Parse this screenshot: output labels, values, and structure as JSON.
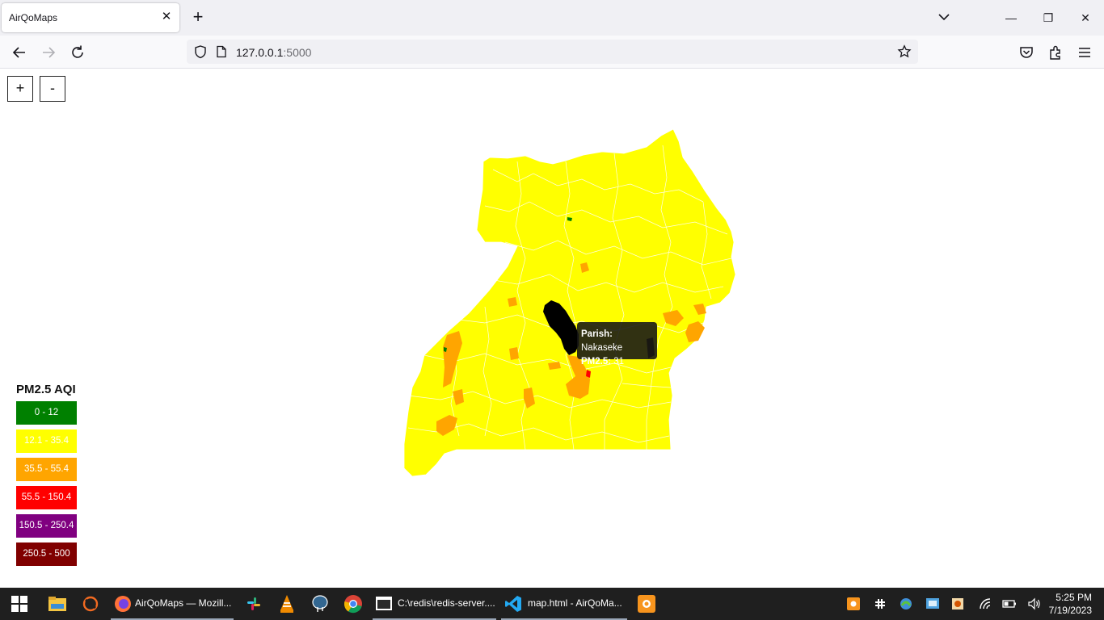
{
  "browser": {
    "tab_title": "AirQoMaps",
    "tab_close": "✕",
    "new_tab": "+",
    "url_host": "127.0.0.1",
    "url_port": ":5000",
    "window_min": "—",
    "window_restore": "❐",
    "window_close": "✕"
  },
  "map": {
    "zoom_in": "+",
    "zoom_out": "-",
    "tooltip": {
      "parish_label": "Parish:",
      "parish_value": "Nakaseke",
      "pm_label": "PM2.5:",
      "pm_value": "31"
    }
  },
  "legend": {
    "title": "PM2.5 AQI",
    "items": [
      {
        "label": "0 - 12",
        "color": "#008000"
      },
      {
        "label": "12.1 - 35.4",
        "color": "#ffff00"
      },
      {
        "label": "35.5 - 55.4",
        "color": "#ffa500"
      },
      {
        "label": "55.5 - 150.4",
        "color": "#ff0000"
      },
      {
        "label": "150.5 - 250.4",
        "color": "#800080"
      },
      {
        "label": "250.5 - 500",
        "color": "#800000"
      }
    ]
  },
  "taskbar": {
    "apps": [
      {
        "name": "windows-start",
        "label": ""
      },
      {
        "name": "file-explorer",
        "label": ""
      },
      {
        "name": "app-orange",
        "label": ""
      },
      {
        "name": "firefox",
        "label": "AirQoMaps — Mozill..."
      },
      {
        "name": "slack",
        "label": ""
      },
      {
        "name": "vlc",
        "label": ""
      },
      {
        "name": "postgres",
        "label": ""
      },
      {
        "name": "chrome",
        "label": ""
      },
      {
        "name": "redis-console",
        "label": "C:\\redis\\redis-server...."
      },
      {
        "name": "vscode",
        "label": "map.html - AirQoMa..."
      },
      {
        "name": "app-orange-square",
        "label": ""
      }
    ],
    "time": "5:25 PM",
    "date": "7/19/2023"
  },
  "colors": {
    "good": "#008000",
    "moderate": "#ffff00",
    "usg": "#ffa500",
    "unhealthy": "#ff0000",
    "highlight": "#000000"
  }
}
